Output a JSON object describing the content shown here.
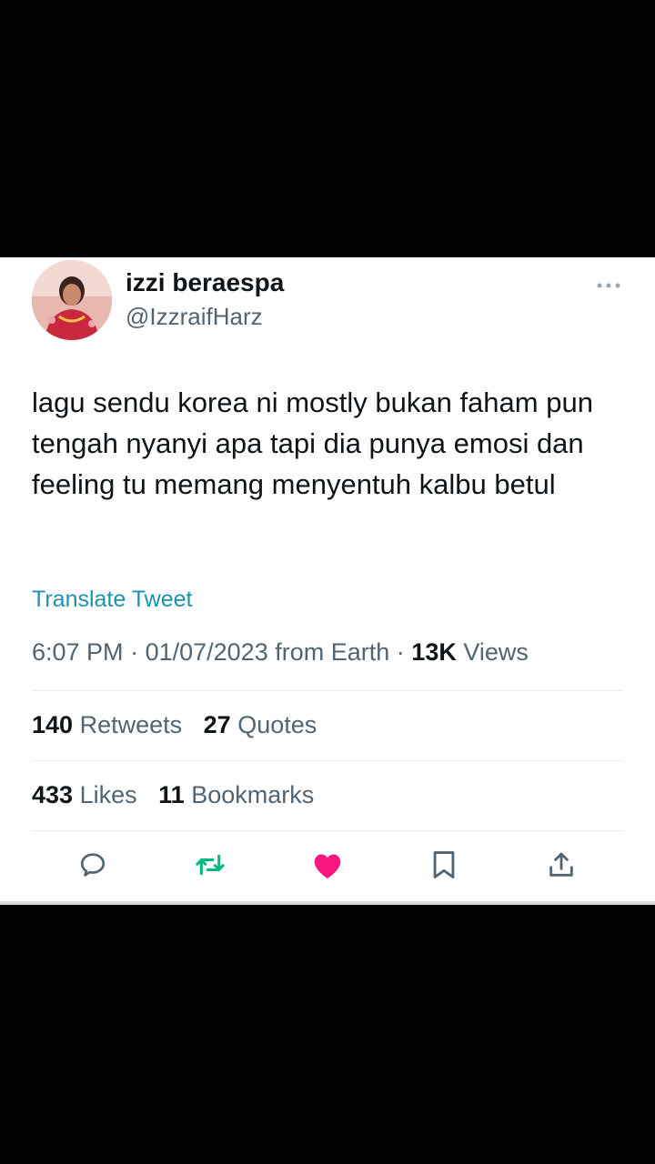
{
  "tweet": {
    "display_name": "izzi beraespa",
    "handle": "@IzzraifHarz",
    "text": "lagu sendu korea ni mostly bukan faham pun tengah nyanyi apa tapi dia punya emosi dan feeling tu memang menyentuh kalbu betul",
    "translate_label": "Translate Tweet",
    "time": "6:07 PM",
    "date": "01/07/2023",
    "location": "from Earth",
    "views_count": "13K",
    "views_label": "Views"
  },
  "stats": {
    "retweets_count": "140",
    "retweets_label": "Retweets",
    "quotes_count": "27",
    "quotes_label": "Quotes",
    "likes_count": "433",
    "likes_label": "Likes",
    "bookmarks_count": "11",
    "bookmarks_label": "Bookmarks"
  },
  "icons": {
    "more": "more-horizontal-icon",
    "reply": "reply-icon",
    "retweet": "retweet-icon",
    "like": "heart-filled-icon",
    "bookmark": "bookmark-icon",
    "share": "share-icon"
  },
  "colors": {
    "retweet": "#00ba7c",
    "like": "#f91880",
    "link": "#1a93b0",
    "secondary_text": "#536471"
  }
}
